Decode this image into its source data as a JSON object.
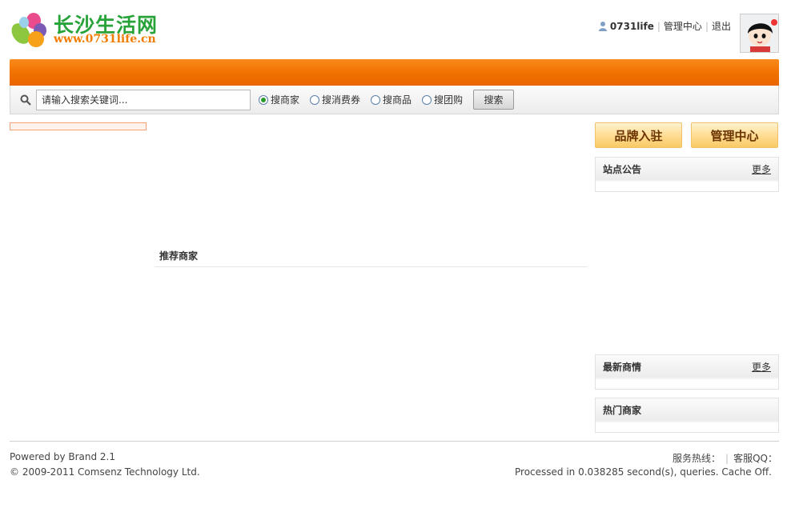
{
  "header": {
    "logo_title": "长沙生活网",
    "logo_url": "www.0731life.cn",
    "username": "0731life",
    "manage_link": "管理中心",
    "logout_link": "退出"
  },
  "search": {
    "placeholder": "请输入搜索关键词...",
    "options": [
      {
        "label": "搜商家",
        "checked": true
      },
      {
        "label": "搜消费券",
        "checked": false
      },
      {
        "label": "搜商品",
        "checked": false
      },
      {
        "label": "搜团购",
        "checked": false
      }
    ],
    "button_label": "搜索"
  },
  "main": {
    "recommend_title": "推荐商家"
  },
  "sidebar": {
    "brand_button": "品牌入驻",
    "manage_button": "管理中心",
    "notice_title": "站点公告",
    "notice_more": "更多",
    "latest_title": "最新商情",
    "latest_more": "更多",
    "hot_title": "热门商家"
  },
  "footer": {
    "powered": "Powered by Brand 2.1",
    "copyright": "© 2009-2011 Comsenz Technology Ltd.",
    "hotline": "服务热线：",
    "qq": "客服QQ：",
    "processed": "Processed in 0.038285 second(s), queries. Cache Off."
  },
  "colors": {
    "brand_green": "#28a33a",
    "brand_orange": "#f07c00",
    "navbar_orange": "#f07000"
  }
}
